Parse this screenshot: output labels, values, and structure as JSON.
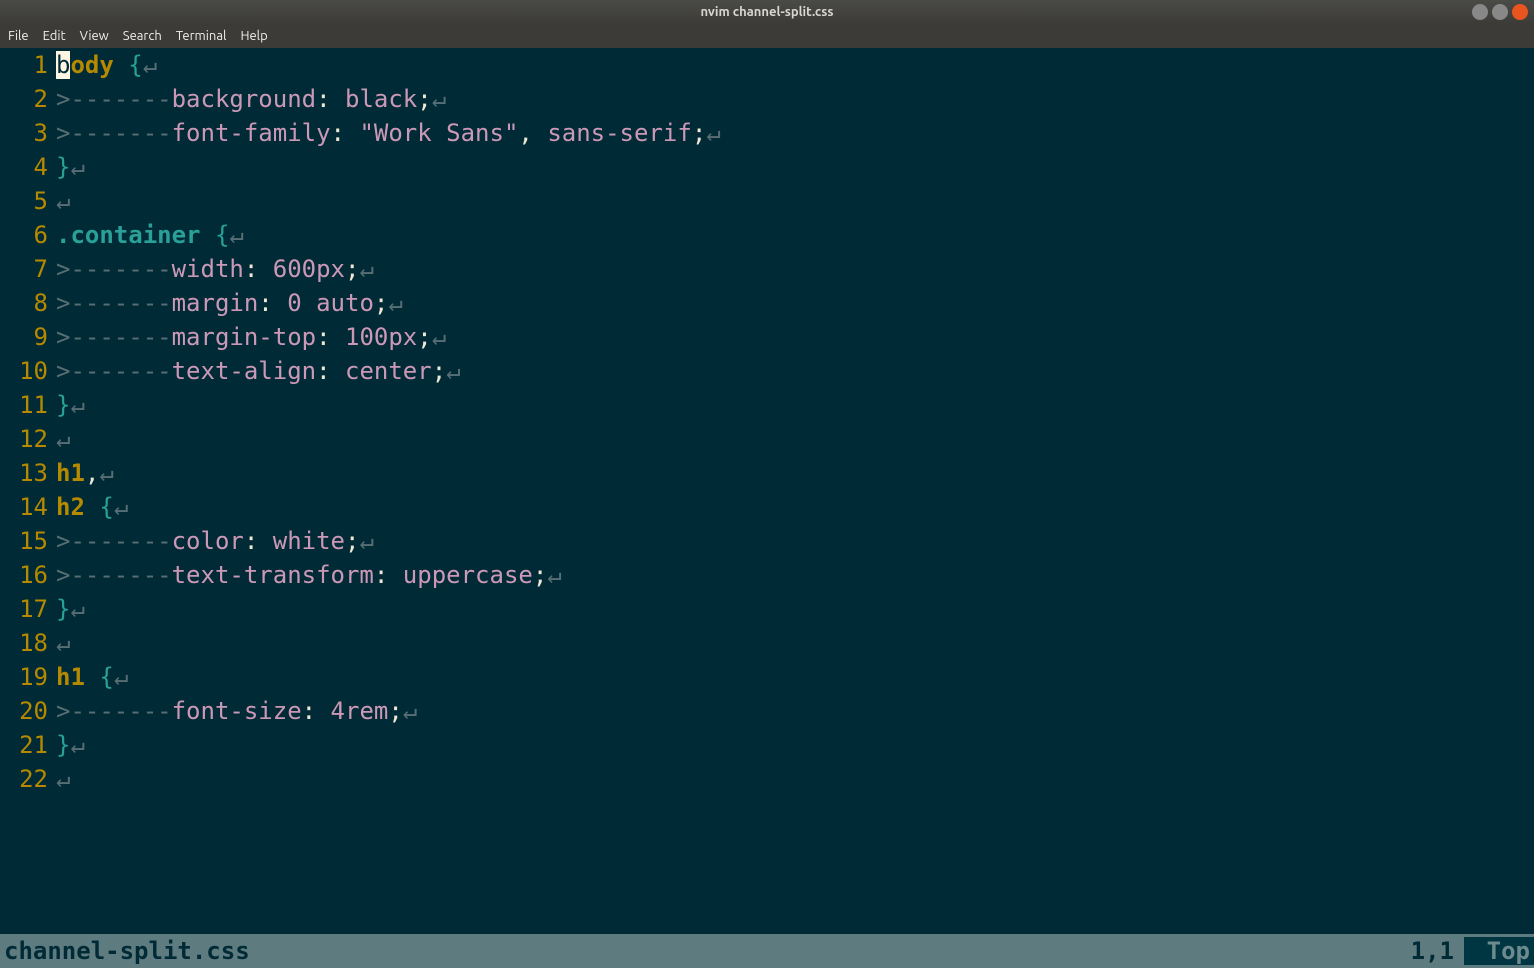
{
  "window": {
    "title": "nvim channel-split.css"
  },
  "menu": {
    "items": [
      "File",
      "Edit",
      "View",
      "Search",
      "Terminal",
      "Help"
    ]
  },
  "status": {
    "file": "channel-split.css",
    "pos": "1,1",
    "scroll": "Top"
  },
  "code": {
    "lines": [
      {
        "n": "1",
        "tokens": [
          [
            "cursor",
            "b"
          ],
          [
            "sel",
            "ody "
          ],
          [
            "brace",
            "{"
          ],
          [
            "eol",
            "↵"
          ]
        ]
      },
      {
        "n": "2",
        "tokens": [
          [
            "list",
            ">-------"
          ],
          [
            "prop",
            "background"
          ],
          [
            "punc",
            ": "
          ],
          [
            "val",
            "black"
          ],
          [
            "punc",
            ";"
          ],
          [
            "eol",
            "↵"
          ]
        ]
      },
      {
        "n": "3",
        "tokens": [
          [
            "list",
            ">-------"
          ],
          [
            "prop",
            "font-family"
          ],
          [
            "punc",
            ": "
          ],
          [
            "val",
            "\"Work Sans\""
          ],
          [
            "norm",
            ", "
          ],
          [
            "val",
            "sans-serif"
          ],
          [
            "punc",
            ";"
          ],
          [
            "eol",
            "↵"
          ]
        ]
      },
      {
        "n": "4",
        "tokens": [
          [
            "brace",
            "}"
          ],
          [
            "eol",
            "↵"
          ]
        ]
      },
      {
        "n": "5",
        "tokens": [
          [
            "eol",
            "↵"
          ]
        ]
      },
      {
        "n": "6",
        "tokens": [
          [
            "class",
            ".container "
          ],
          [
            "brace",
            "{"
          ],
          [
            "eol",
            "↵"
          ]
        ]
      },
      {
        "n": "7",
        "tokens": [
          [
            "list",
            ">-------"
          ],
          [
            "prop",
            "width"
          ],
          [
            "punc",
            ": "
          ],
          [
            "val",
            "600px"
          ],
          [
            "punc",
            ";"
          ],
          [
            "eol",
            "↵"
          ]
        ]
      },
      {
        "n": "8",
        "tokens": [
          [
            "list",
            ">-------"
          ],
          [
            "prop",
            "margin"
          ],
          [
            "punc",
            ": "
          ],
          [
            "val",
            "0"
          ],
          [
            "norm",
            " "
          ],
          [
            "val",
            "auto"
          ],
          [
            "punc",
            ";"
          ],
          [
            "eol",
            "↵"
          ]
        ]
      },
      {
        "n": "9",
        "tokens": [
          [
            "list",
            ">-------"
          ],
          [
            "prop",
            "margin-top"
          ],
          [
            "punc",
            ": "
          ],
          [
            "val",
            "100px"
          ],
          [
            "punc",
            ";"
          ],
          [
            "eol",
            "↵"
          ]
        ]
      },
      {
        "n": "10",
        "tokens": [
          [
            "list",
            ">-------"
          ],
          [
            "prop",
            "text-align"
          ],
          [
            "punc",
            ": "
          ],
          [
            "val",
            "center"
          ],
          [
            "punc",
            ";"
          ],
          [
            "eol",
            "↵"
          ]
        ]
      },
      {
        "n": "11",
        "tokens": [
          [
            "brace",
            "}"
          ],
          [
            "eol",
            "↵"
          ]
        ]
      },
      {
        "n": "12",
        "tokens": [
          [
            "eol",
            "↵"
          ]
        ]
      },
      {
        "n": "13",
        "tokens": [
          [
            "sel",
            "h1"
          ],
          [
            "norm",
            ","
          ],
          [
            "eol",
            "↵"
          ]
        ]
      },
      {
        "n": "14",
        "tokens": [
          [
            "sel",
            "h2 "
          ],
          [
            "brace",
            "{"
          ],
          [
            "eol",
            "↵"
          ]
        ]
      },
      {
        "n": "15",
        "tokens": [
          [
            "list",
            ">-------"
          ],
          [
            "prop",
            "color"
          ],
          [
            "punc",
            ": "
          ],
          [
            "val",
            "white"
          ],
          [
            "punc",
            ";"
          ],
          [
            "eol",
            "↵"
          ]
        ]
      },
      {
        "n": "16",
        "tokens": [
          [
            "list",
            ">-------"
          ],
          [
            "prop",
            "text-transform"
          ],
          [
            "punc",
            ": "
          ],
          [
            "val",
            "uppercase"
          ],
          [
            "punc",
            ";"
          ],
          [
            "eol",
            "↵"
          ]
        ]
      },
      {
        "n": "17",
        "tokens": [
          [
            "brace",
            "}"
          ],
          [
            "eol",
            "↵"
          ]
        ]
      },
      {
        "n": "18",
        "tokens": [
          [
            "eol",
            "↵"
          ]
        ]
      },
      {
        "n": "19",
        "tokens": [
          [
            "sel",
            "h1 "
          ],
          [
            "brace",
            "{"
          ],
          [
            "eol",
            "↵"
          ]
        ]
      },
      {
        "n": "20",
        "tokens": [
          [
            "list",
            ">-------"
          ],
          [
            "prop",
            "font-size"
          ],
          [
            "punc",
            ": "
          ],
          [
            "val",
            "4rem"
          ],
          [
            "punc",
            ";"
          ],
          [
            "eol",
            "↵"
          ]
        ]
      },
      {
        "n": "21",
        "tokens": [
          [
            "brace",
            "}"
          ],
          [
            "eol",
            "↵"
          ]
        ]
      },
      {
        "n": "22",
        "tokens": [
          [
            "eol",
            "↵"
          ]
        ]
      }
    ]
  }
}
